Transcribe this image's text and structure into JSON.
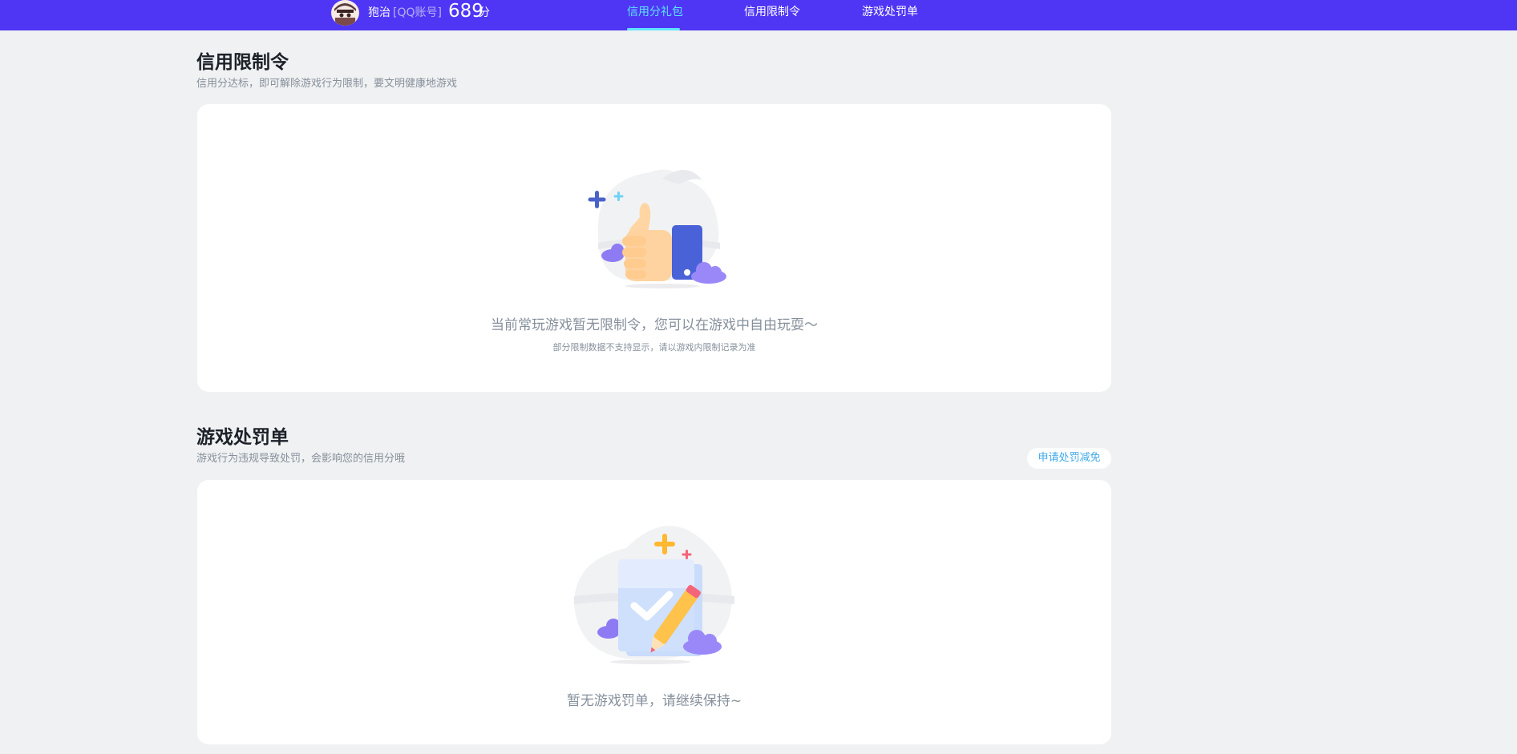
{
  "header": {
    "user_name": "狍治",
    "account_type": "[QQ账号]",
    "score": "689",
    "score_unit": "分",
    "tabs": [
      {
        "label": "信用分礼包",
        "active": true
      },
      {
        "label": "信用限制令",
        "active": false
      },
      {
        "label": "游戏处罚单",
        "active": false
      }
    ]
  },
  "restriction": {
    "title": "信用限制令",
    "subtitle": "信用分达标，即可解除游戏行为限制，要文明健康地游戏",
    "empty_message": "当前常玩游戏暂无限制令，您可以在游戏中自由玩耍～",
    "empty_note": "部分限制数据不支持显示，请以游戏内限制记录为准"
  },
  "penalty": {
    "title": "游戏处罚单",
    "subtitle": "游戏行为违规导致处罚，会影响您的信用分哦",
    "appeal_button": "申请处罚减免",
    "empty_message": "暂无游戏罚单，请继续保持~"
  },
  "colors": {
    "header_bg": "#4f36f5",
    "active_tab": "#5fe3ff",
    "accent_link": "#3fa9e9",
    "page_bg": "#f0f1f2"
  }
}
